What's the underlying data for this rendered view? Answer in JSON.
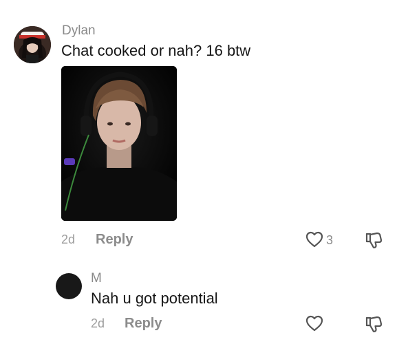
{
  "comments": [
    {
      "username": "Dylan",
      "text": "Chat cooked or nah? 16 btw",
      "time": "2d",
      "reply_label": "Reply",
      "like_count": "3",
      "avatar_icon": "user-avatar-photo",
      "image_icon": "attached-photo"
    }
  ],
  "replies": [
    {
      "username": "M",
      "text": "Nah u got potential",
      "time": "2d",
      "reply_label": "Reply",
      "like_count": "",
      "avatar_color": "#181818"
    }
  ],
  "icons": {
    "like": "heart-outline-icon",
    "dislike": "thumbs-down-outline-icon"
  },
  "colors": {
    "meta_gray": "#9d9d9d",
    "username_gray": "#8a8a8a",
    "text": "#161616"
  }
}
